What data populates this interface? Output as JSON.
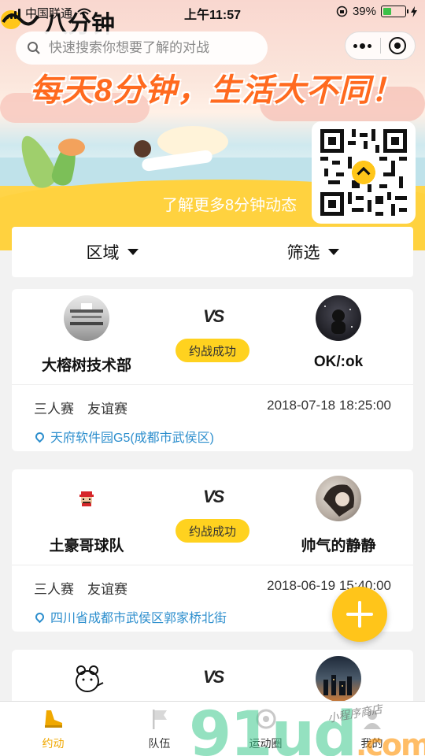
{
  "status_bar": {
    "carrier": "中国联通",
    "time": "上午11:57",
    "battery_percent": "39%",
    "battery_level": 0.39
  },
  "app": {
    "logo_text": "八分钟"
  },
  "search": {
    "placeholder": "快速搜索你想要了解的对战"
  },
  "banner": {
    "slogan": "每天8分钟，生活大不同！",
    "more_link": "了解更多8分钟动态"
  },
  "filters": {
    "region_label": "区域",
    "filter_label": "筛选"
  },
  "matches": [
    {
      "team_a": "大榕树技术部",
      "team_b": "OK/:ok",
      "vs": "VS",
      "status": "约战成功",
      "type": "三人赛　友谊赛",
      "datetime": "2018-07-18 18:25:00",
      "location": "天府软件园G5(成都市武侯区)"
    },
    {
      "team_a": "土豪哥球队",
      "team_b": "帅气的静静",
      "vs": "VS",
      "status": "约战成功",
      "type": "三人赛　友谊赛",
      "datetime": "2018-06-19 15:40:00",
      "location": "四川省成都市武侯区郭家桥北街"
    },
    {
      "team_a": "",
      "team_b": "",
      "vs": "VS",
      "status": "",
      "type": "",
      "datetime": "",
      "location": ""
    }
  ],
  "tabs": [
    {
      "label": "约动",
      "icon": "shoe-icon",
      "active": true
    },
    {
      "label": "队伍",
      "icon": "flag-icon",
      "active": false
    },
    {
      "label": "运动圈",
      "icon": "circle-icon",
      "active": false
    },
    {
      "label": "我的",
      "icon": "user-icon",
      "active": false
    }
  ],
  "watermark": {
    "text": "91ud",
    "suffix": ".com",
    "small": "小程序商店"
  },
  "colors": {
    "accent": "#ffd21f",
    "tab_active": "#f0a800",
    "location_link": "#2c8ecd",
    "slogan": "#ff6a1f"
  }
}
